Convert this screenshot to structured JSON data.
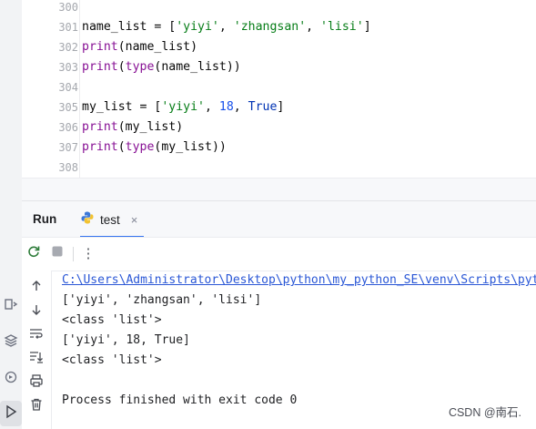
{
  "editor": {
    "line_numbers": [
      "300",
      "301",
      "302",
      "303",
      "304",
      "305",
      "306",
      "307",
      "308"
    ],
    "lines": [
      {
        "parts": []
      },
      {
        "parts": [
          {
            "t": "name_list = [",
            "c": "c-def"
          },
          {
            "t": "'yiyi'",
            "c": "c-str"
          },
          {
            "t": ", ",
            "c": "c-def"
          },
          {
            "t": "'zhangsan'",
            "c": "c-str"
          },
          {
            "t": ", ",
            "c": "c-def"
          },
          {
            "t": "'lisi'",
            "c": "c-str"
          },
          {
            "t": "]",
            "c": "c-def"
          }
        ]
      },
      {
        "parts": [
          {
            "t": "print",
            "c": "c-fn"
          },
          {
            "t": "(name_list)",
            "c": "c-def"
          }
        ]
      },
      {
        "parts": [
          {
            "t": "print",
            "c": "c-fn"
          },
          {
            "t": "(",
            "c": "c-def"
          },
          {
            "t": "type",
            "c": "c-fn"
          },
          {
            "t": "(name_list))",
            "c": "c-def"
          }
        ]
      },
      {
        "parts": []
      },
      {
        "parts": [
          {
            "t": "my_list = [",
            "c": "c-def"
          },
          {
            "t": "'yiyi'",
            "c": "c-str"
          },
          {
            "t": ", ",
            "c": "c-def"
          },
          {
            "t": "18",
            "c": "c-num"
          },
          {
            "t": ", ",
            "c": "c-def"
          },
          {
            "t": "True",
            "c": "c-kw"
          },
          {
            "t": "]",
            "c": "c-def"
          }
        ]
      },
      {
        "parts": [
          {
            "t": "print",
            "c": "c-fn"
          },
          {
            "t": "(my_list)",
            "c": "c-def"
          }
        ]
      },
      {
        "parts": [
          {
            "t": "print",
            "c": "c-fn"
          },
          {
            "t": "(",
            "c": "c-def"
          },
          {
            "t": "type",
            "c": "c-fn"
          },
          {
            "t": "(my_list))",
            "c": "c-def"
          }
        ]
      },
      {
        "parts": []
      }
    ]
  },
  "run_panel": {
    "title": "Run",
    "tab_label": "test",
    "tab_icon": "python-icon",
    "tab_close": "×",
    "toolbar_more": "⋮"
  },
  "console": {
    "command_path": "C:\\Users\\Administrator\\Desktop\\python\\my_python_SE\\venv\\Scripts\\python.exe",
    "output_lines": [
      "['yiyi', 'zhangsan', 'lisi']",
      "<class 'list'>",
      "['yiyi', 18, True]",
      "<class 'list'>",
      "",
      "Process finished with exit code 0"
    ]
  },
  "watermark": "CSDN @南石.",
  "colors": {
    "accent": "#3574f0",
    "function": "#871094",
    "string": "#067d17",
    "number": "#1750eb",
    "keyword": "#0033b3",
    "link": "#2a57d6"
  }
}
